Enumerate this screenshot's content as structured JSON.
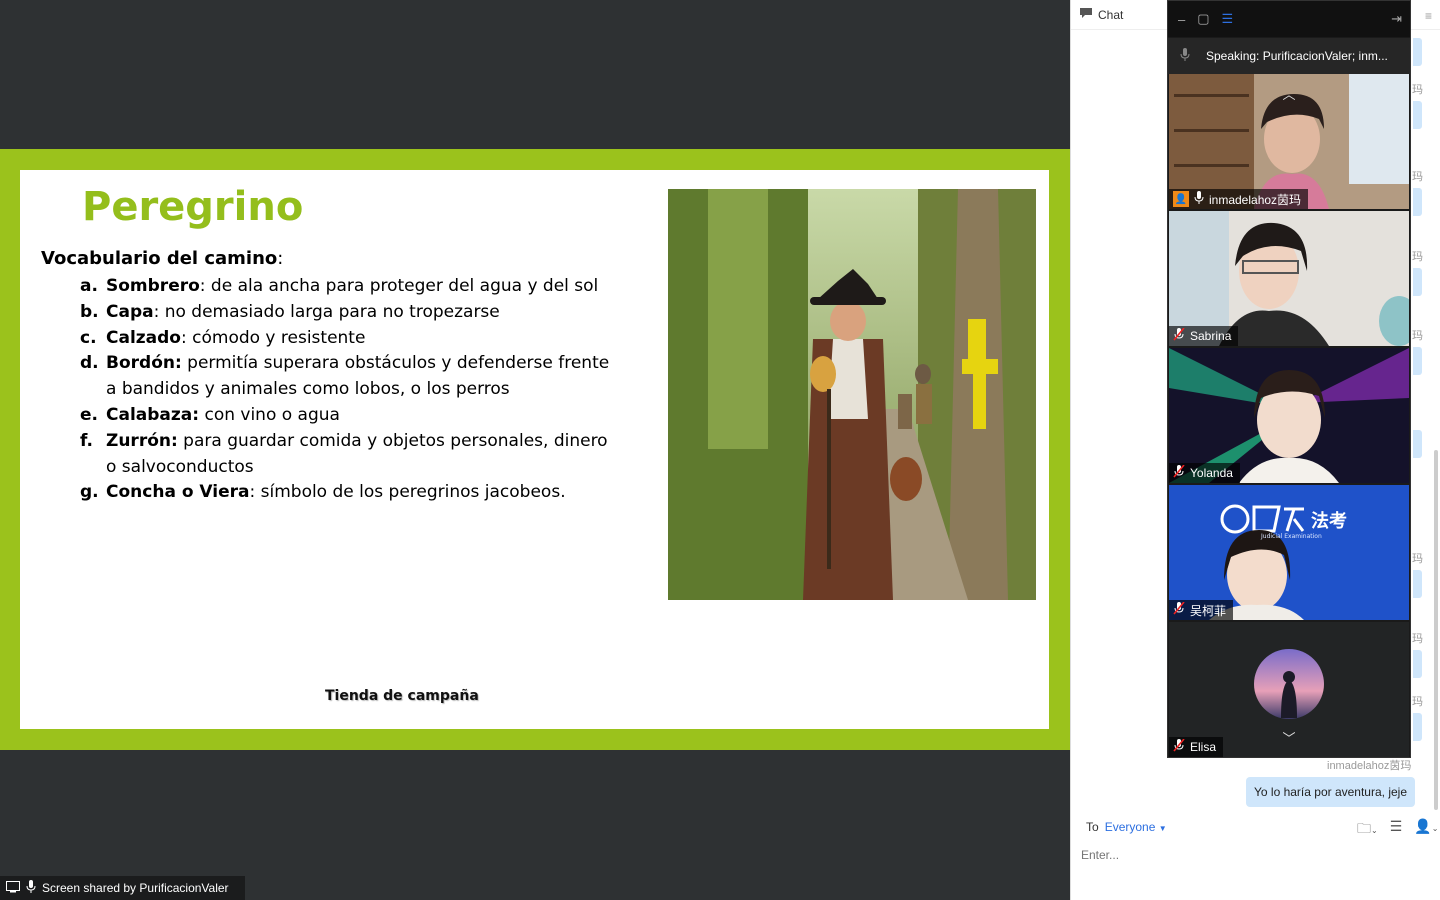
{
  "slide": {
    "title": "Peregrino",
    "vocab_heading_bold": "Vocabulario del camino",
    "vocab_heading_rest": ":",
    "items": [
      {
        "letter": "a.",
        "term": "Sombrero",
        "rest": ": de ala ancha para proteger del agua y del sol"
      },
      {
        "letter": "b.",
        "term": "Capa",
        "rest": ": no demasiado larga para no tropezarse"
      },
      {
        "letter": "c.",
        "term": "Calzado",
        "rest": ": cómodo y resistente"
      },
      {
        "letter": "d.",
        "term": "Bordón:",
        "rest": " permitía superara obstáculos y defenderse frente a bandidos y animales como lobos, o los perros"
      },
      {
        "letter": "e.",
        "term": "Calabaza:",
        "rest": " con vino o agua"
      },
      {
        "letter": "f.",
        "term": "Zurrón:",
        "rest": " para guardar comida y objetos personales, dinero o salvoconductos"
      },
      {
        "letter": "g.",
        "term": "Concha o Viera",
        "rest": ": símbolo de los peregrinos jacobeos."
      }
    ],
    "caption": "Tienda de campaña"
  },
  "share_bar": {
    "text": "Screen shared by PurificacionValer"
  },
  "chat": {
    "header_label": "Chat",
    "name_fragment": "玛",
    "last_sender": "inmadelahoz茵玛",
    "last_message": "Yo lo haría por aventura, jeje",
    "to_label": "To",
    "to_value": "Everyone",
    "input_placeholder": "Enter..."
  },
  "gallery": {
    "speaking": "Speaking: PurificacionValer; inm...",
    "participants": [
      {
        "name": "inmadelahoz茵玛",
        "muted": false,
        "host": true
      },
      {
        "name": "Sabrina",
        "muted": true,
        "host": false
      },
      {
        "name": "Yolanda",
        "muted": true,
        "host": false
      },
      {
        "name": "吴柯菲",
        "muted": true,
        "host": false
      },
      {
        "name": "Elisa",
        "muted": true,
        "host": false
      }
    ],
    "tile4_logo_text": "法考",
    "tile4_sub_text": "Judicial Examination"
  }
}
